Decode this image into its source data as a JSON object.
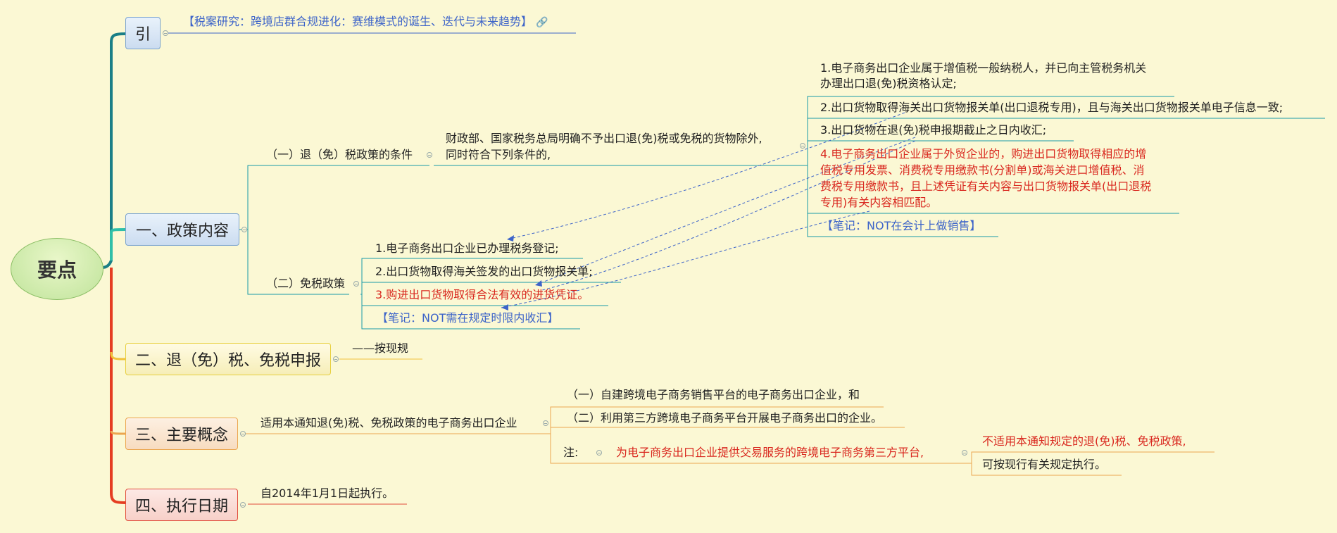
{
  "root": {
    "label": "要点"
  },
  "intro": {
    "label": "引",
    "link_text": "【税案研究：跨境店群合规进化：赛维模式的诞生、迭代与未来趋势】"
  },
  "section1": {
    "label": "一、政策内容",
    "sub1": {
      "label": "（一）退（免）税政策的条件",
      "desc_line1": "财政部、国家税务总局明确不予出口退(免)税或免税的货物除外,",
      "desc_line2": "同时符合下列条件的,",
      "cond1_line1": "1.电子商务出口企业属于增值税一般纳税人，并已向主管税务机关",
      "cond1_line2": "办理出口退(免)税资格认定;",
      "cond2": "2.出口货物取得海关出口货物报关单(出口退税专用)，且与海关出口货物报关单电子信息一致;",
      "cond3": "3.出口货物在退(免)税申报期截止之日内收汇;",
      "cond4_line1": "4.电子商务出口企业属于外贸企业的，购进出口货物取得相应的增",
      "cond4_line2": "值税专用发票、消费税专用缴款书(分割单)或海关进口增值税、消",
      "cond4_line3": "费税专用缴款书，且上述凭证有关内容与出口货物报关单(出口退税",
      "cond4_line4": "专用)有关内容相匹配。",
      "note": "【笔记：NOT在会计上做销售】"
    },
    "sub2": {
      "label": "（二）免税政策",
      "item1": "1.电子商务出口企业已办理税务登记;",
      "item2": "2.出口货物取得海关签发的出口货物报关单;",
      "item3": "3.购进出口货物取得合法有效的进货凭证。",
      "note": "【笔记：NOT需在规定时限内收汇】"
    }
  },
  "section2": {
    "label": "二、退（免）税、免税申报",
    "note": "——按现规"
  },
  "section3": {
    "label": "三、主要概念",
    "desc": "适用本通知退(免)税、免税政策的电子商务出口企业",
    "item1": "（一）自建跨境电子商务销售平台的电子商务出口企业，和",
    "item2": "（二）利用第三方跨境电子商务平台开展电子商务出口的企业。",
    "note_label": "注:",
    "note_text": "为电子商务出口企业提供交易服务的跨境电子商务第三方平台,",
    "note_result1": "不适用本通知规定的退(免)税、免税政策,",
    "note_result2": "可按现行有关规定执行。"
  },
  "section4": {
    "label": "四、执行日期",
    "text": "自2014年1月1日起执行。"
  },
  "colors": {
    "background": "#fbf8d4",
    "teal": "#1a8c8c",
    "red": "#d9281f",
    "blue": "#3d64c9",
    "orange": "#eba64f",
    "yellow": "#e7cf3c"
  }
}
